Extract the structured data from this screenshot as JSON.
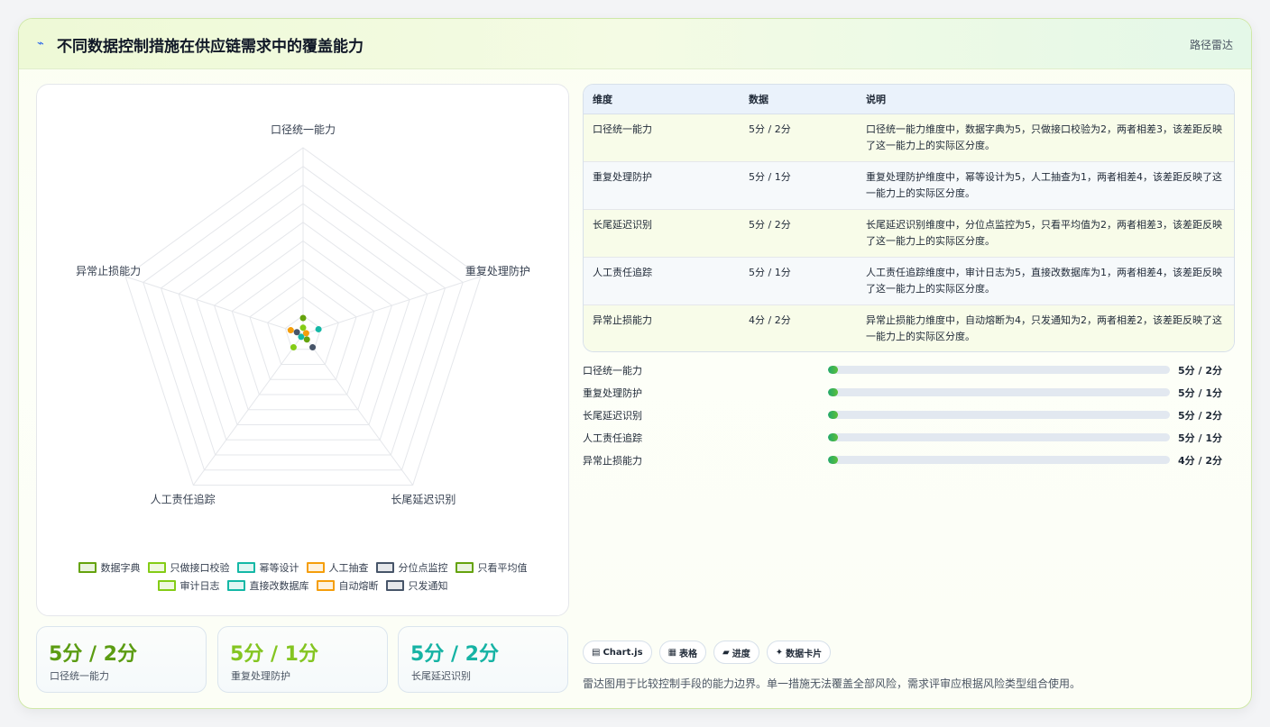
{
  "header": {
    "title_icon": "⌁",
    "title": "不同数据控制措施在供应链需求中的覆盖能力",
    "tag": "路径雷达"
  },
  "chart_data": {
    "type": "radar",
    "axes": [
      "口径统一能力",
      "重复处理防护",
      "长尾延迟识别",
      "人工责任追踪",
      "异常止损能力"
    ],
    "scale_max": 5,
    "series": [
      {
        "name": "数据字典",
        "values": [
          5,
          null,
          null,
          null,
          null
        ],
        "color": "#65a30d"
      },
      {
        "name": "只做接口校验",
        "values": [
          2,
          null,
          null,
          null,
          null
        ],
        "color": "#84cc16"
      },
      {
        "name": "幂等设计",
        "values": [
          null,
          5,
          null,
          null,
          null
        ],
        "color": "#14b8a6"
      },
      {
        "name": "人工抽查",
        "values": [
          null,
          1,
          null,
          null,
          null
        ],
        "color": "#f59e0b"
      },
      {
        "name": "分位点监控",
        "values": [
          null,
          null,
          5,
          null,
          null
        ],
        "color": "#475569"
      },
      {
        "name": "只看平均值",
        "values": [
          null,
          null,
          2,
          null,
          null
        ],
        "color": "#65a30d"
      },
      {
        "name": "审计日志",
        "values": [
          null,
          null,
          null,
          5,
          null
        ],
        "color": "#84cc16"
      },
      {
        "name": "直接改数据库",
        "values": [
          null,
          null,
          null,
          1,
          null
        ],
        "color": "#14b8a6"
      },
      {
        "name": "自动熔断",
        "values": [
          null,
          null,
          null,
          null,
          4
        ],
        "color": "#f59e0b"
      },
      {
        "name": "只发通知",
        "values": [
          null,
          null,
          null,
          null,
          2
        ],
        "color": "#475569"
      }
    ]
  },
  "stats": [
    {
      "value": "5分 / 2分",
      "label": "口径统一能力",
      "color": "#5b9c12"
    },
    {
      "value": "5分 / 1分",
      "label": "重复处理防护",
      "color": "#84c521"
    },
    {
      "value": "5分 / 2分",
      "label": "长尾延迟识别",
      "color": "#16b3a4"
    }
  ],
  "table": {
    "headers": [
      "维度",
      "数据",
      "说明"
    ],
    "rows": [
      {
        "dim": "口径统一能力",
        "data": "5分 / 2分",
        "desc": "口径统一能力维度中，数据字典为5，只做接口校验为2，两者相差3，该差距反映了这一能力上的实际区分度。"
      },
      {
        "dim": "重复处理防护",
        "data": "5分 / 1分",
        "desc": "重复处理防护维度中，幂等设计为5，人工抽查为1，两者相差4，该差距反映了这一能力上的实际区分度。"
      },
      {
        "dim": "长尾延迟识别",
        "data": "5分 / 2分",
        "desc": "长尾延迟识别维度中，分位点监控为5，只看平均值为2，两者相差3，该差距反映了这一能力上的实际区分度。"
      },
      {
        "dim": "人工责任追踪",
        "data": "5分 / 1分",
        "desc": "人工责任追踪维度中，审计日志为5，直接改数据库为1，两者相差4，该差距反映了这一能力上的实际区分度。"
      },
      {
        "dim": "异常止损能力",
        "data": "4分 / 2分",
        "desc": "异常止损能力维度中，自动熔断为4，只发通知为2，两者相差2，该差距反映了这一能力上的实际区分度。"
      }
    ]
  },
  "progress": [
    {
      "label": "口径统一能力",
      "value": "5分 / 2分",
      "fill_fraction": 0.03
    },
    {
      "label": "重复处理防护",
      "value": "5分 / 1分",
      "fill_fraction": 0.03
    },
    {
      "label": "长尾延迟识别",
      "value": "5分 / 2分",
      "fill_fraction": 0.03
    },
    {
      "label": "人工责任追踪",
      "value": "5分 / 1分",
      "fill_fraction": 0.03
    },
    {
      "label": "异常止损能力",
      "value": "4分 / 2分",
      "fill_fraction": 0.03
    }
  ],
  "chips": [
    {
      "icon": "▤",
      "label": "Chart.js"
    },
    {
      "icon": "▦",
      "label": "表格"
    },
    {
      "icon": "▰",
      "label": "进度"
    },
    {
      "icon": "✦",
      "label": "数据卡片"
    }
  ],
  "note": "雷达图用于比较控制手段的能力边界。单一措施无法覆盖全部风险，需求评审应根据风险类型组合使用。"
}
